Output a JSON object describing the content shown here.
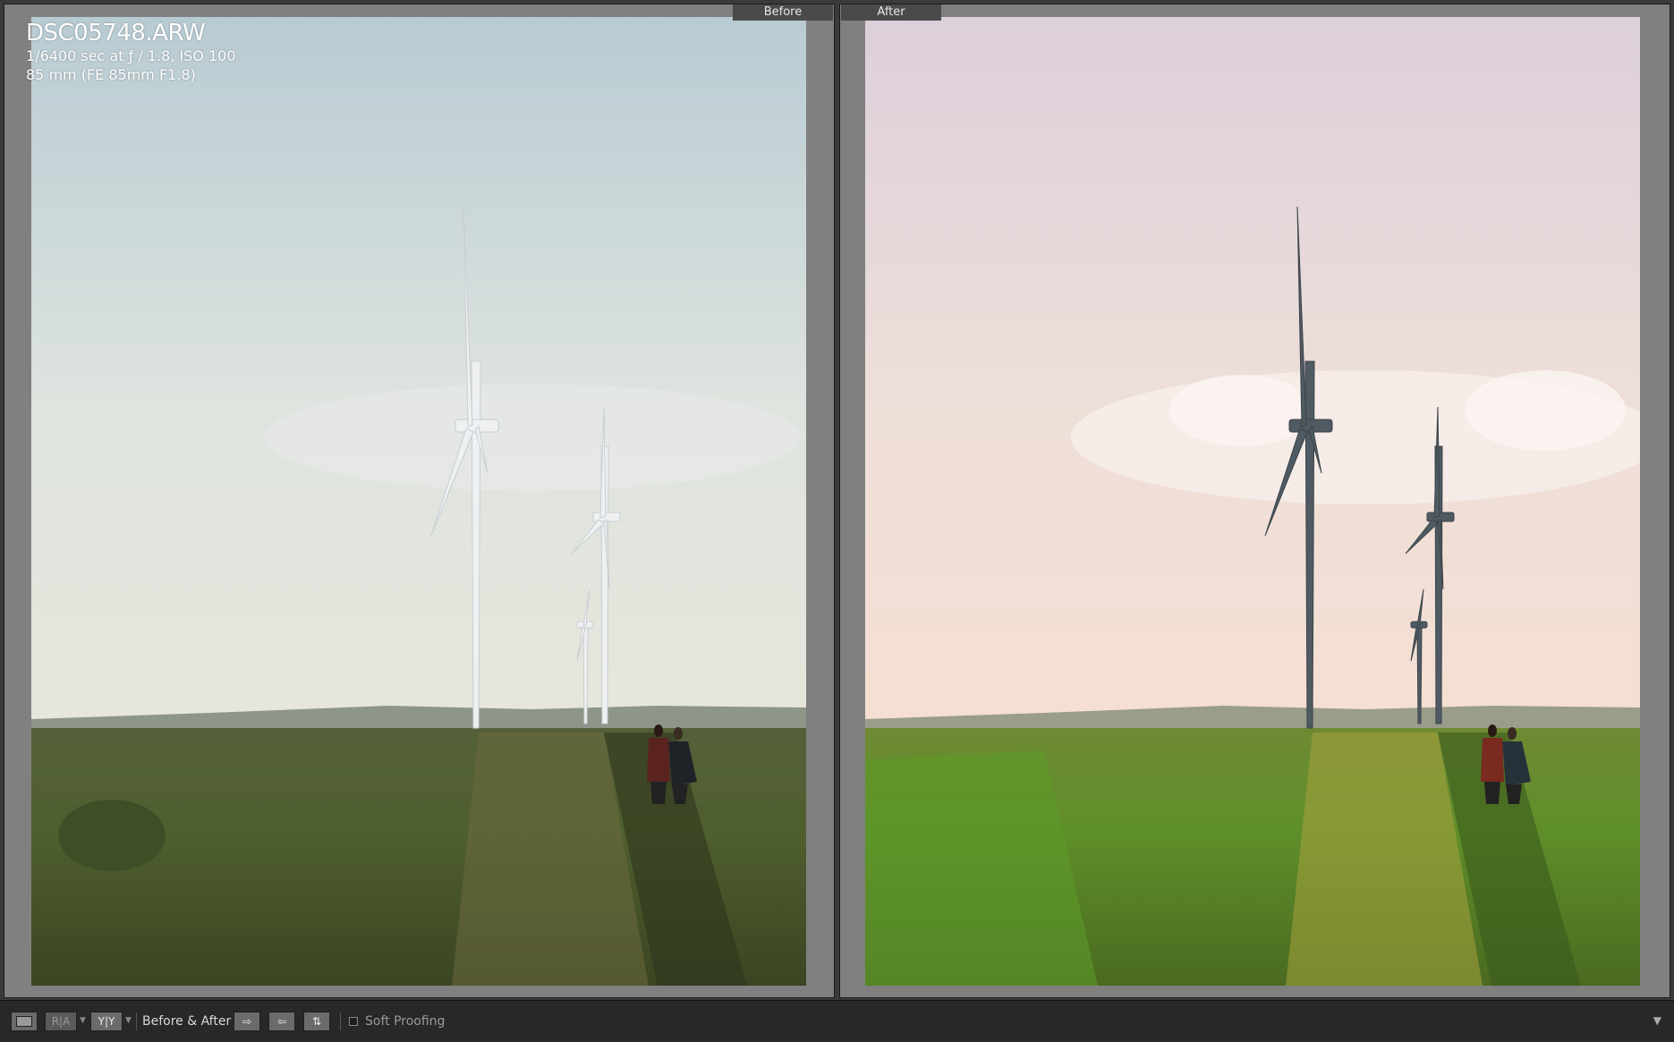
{
  "file_info": {
    "filename": "DSC05748.ARW",
    "exposure": "1/6400 sec at ƒ / 1.8, ISO 100",
    "lens": "85 mm (FE 85mm F1.8)"
  },
  "panes": {
    "before_label": "Before",
    "after_label": "After"
  },
  "toolbar": {
    "ra_label": "R|A",
    "yy_label": "Y|Y",
    "before_after_label": "Before & After :",
    "soft_proofing_label": "Soft Proofing",
    "soft_proofing_checked": false
  },
  "icons": {
    "loupe": "loupe-view-icon",
    "swap_right": "copy-before-to-after-icon",
    "swap_left": "copy-after-to-before-icon",
    "swap": "swap-before-after-icon",
    "menu": "chevron-down-icon"
  },
  "colors": {
    "before_sky_top": "#b9ccd4",
    "before_sky_bottom": "#dde2dd",
    "after_sky_top": "#ddd0dc",
    "after_sky_bottom": "#f3dfd6",
    "before_grass": "#4c5a30",
    "after_grass": "#5e8a2c"
  }
}
